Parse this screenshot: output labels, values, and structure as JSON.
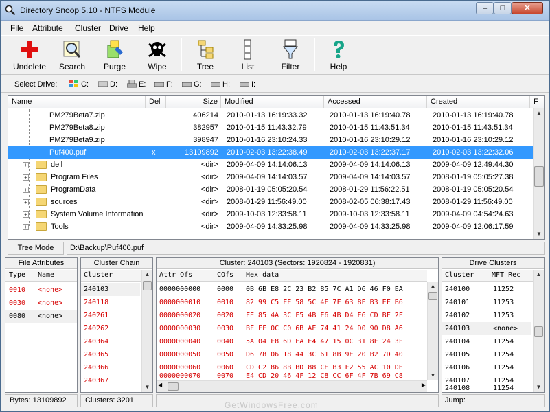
{
  "window": {
    "title": "Directory Snoop 5.10 - NTFS Module",
    "min_label": "–",
    "max_label": "□",
    "close_label": "✕"
  },
  "menu": [
    "File",
    "Attribute",
    "Cluster",
    "Drive",
    "Help"
  ],
  "toolbar": {
    "undelete": "Undelete",
    "search": "Search",
    "purge": "Purge",
    "wipe": "Wipe",
    "tree": "Tree",
    "list": "List",
    "filter": "Filter",
    "help": "Help"
  },
  "drives": {
    "label": "Select Drive:",
    "items": [
      "C:",
      "D:",
      "E:",
      "F:",
      "G:",
      "H:",
      "I:"
    ]
  },
  "file_list": {
    "columns": [
      "Name",
      "Del",
      "Size",
      "Modified",
      "Accessed",
      "Created",
      "F"
    ],
    "rows": [
      {
        "name": "PM279Beta7.zip",
        "del": "",
        "size": "406214",
        "modified": "2010-01-13  16:19:33.32",
        "accessed": "2010-01-13  16:19:40.78",
        "created": "2010-01-13  16:19:40.78"
      },
      {
        "name": "PM279Beta8.zip",
        "del": "",
        "size": "382957",
        "modified": "2010-01-15  11:43:32.79",
        "accessed": "2010-01-15  11:43:51.34",
        "created": "2010-01-15  11:43:51.34"
      },
      {
        "name": "PM279Beta9.zip",
        "del": "",
        "size": "398947",
        "modified": "2010-01-16  23:10:24.33",
        "accessed": "2010-01-16  23:10:29.12",
        "created": "2010-01-16  23:10:29.12"
      },
      {
        "name": "Puf400.puf",
        "del": "x",
        "size": "13109892",
        "modified": "2010-02-03  13:22:38.49",
        "accessed": "2010-02-03  13:22:37.17",
        "created": "2010-02-03  13:22:32.06"
      },
      {
        "name": "dell",
        "del": "",
        "size": "<dir>",
        "modified": "2009-04-09  14:14:06.13",
        "accessed": "2009-04-09  14:14:06.13",
        "created": "2009-04-09  12:49:44.30"
      },
      {
        "name": "Program Files",
        "del": "",
        "size": "<dir>",
        "modified": "2009-04-09  14:14:03.57",
        "accessed": "2009-04-09  14:14:03.57",
        "created": "2008-01-19  05:05:27.38"
      },
      {
        "name": "ProgramData",
        "del": "",
        "size": "<dir>",
        "modified": "2008-01-19  05:05:20.54",
        "accessed": "2008-01-29  11:56:22.51",
        "created": "2008-01-19  05:05:20.54"
      },
      {
        "name": "sources",
        "del": "",
        "size": "<dir>",
        "modified": "2008-01-29  11:56:49.00",
        "accessed": "2008-02-05  06:38:17.43",
        "created": "2008-01-29  11:56:49.00"
      },
      {
        "name": "System Volume Information",
        "del": "",
        "size": "<dir>",
        "modified": "2009-10-03  12:33:58.11",
        "accessed": "2009-10-03  12:33:58.11",
        "created": "2009-04-09  04:54:24.63"
      },
      {
        "name": "Tools",
        "del": "",
        "size": "<dir>",
        "modified": "2009-04-09  14:33:25.98",
        "accessed": "2009-04-09  14:33:25.98",
        "created": "2009-04-09  12:06:17.59"
      }
    ]
  },
  "status": {
    "mode": "Tree Mode",
    "path": "D:\\Backup\\Puf400.puf"
  },
  "file_attributes": {
    "title": "File Attributes",
    "headers": [
      "Type",
      "Name"
    ],
    "rows": [
      {
        "type": "0010",
        "name": "<none>"
      },
      {
        "type": "0030",
        "name": "<none>"
      },
      {
        "type": "0080",
        "name": "<none>"
      }
    ],
    "footer": "Bytes: 13109892"
  },
  "cluster_chain": {
    "title": "Cluster Chain",
    "header": "Cluster",
    "rows": [
      "240103",
      "240118",
      "240261",
      "240262",
      "240364",
      "240365",
      "240366",
      "240367"
    ],
    "footer": "Clusters: 3201"
  },
  "hex_view": {
    "title": "Cluster: 240103 (Sectors: 1920824 - 1920831)",
    "headers": [
      "Attr Ofs",
      "COfs",
      "Hex data"
    ],
    "rows": [
      {
        "ofs": "0000000000",
        "cofs": "0000",
        "hex": "0B 6B E8 2C 23 B2 85 7C A1 D6 46 F0 EA"
      },
      {
        "ofs": "0000000010",
        "cofs": "0010",
        "hex": "82 99 C5 FE 58 5C 4F 7F 63 8E B3 EF B6"
      },
      {
        "ofs": "0000000020",
        "cofs": "0020",
        "hex": "FE 85 4A 3C F5 4B E6 4B D4 E6 CD BF 2F"
      },
      {
        "ofs": "0000000030",
        "cofs": "0030",
        "hex": "BF FF 0C C0 6B AE 74 41 24 D0 90 D8 A6"
      },
      {
        "ofs": "0000000040",
        "cofs": "0040",
        "hex": "5A 04 F8 6D EA E4 47 15 0C 31 8F 24 3F"
      },
      {
        "ofs": "0000000050",
        "cofs": "0050",
        "hex": "D6 78 06 18 44 3C 61 8B 9E 20 B2 7D 40"
      },
      {
        "ofs": "0000000060",
        "cofs": "0060",
        "hex": "CD C2 86 8B BD 88 CE B3 F2 55 AC 10 DE"
      },
      {
        "ofs": "0000000070",
        "cofs": "0070",
        "hex": "E4 CD 20 46 4F 12 C8 CC 6F 4F 7B 69 C8"
      }
    ]
  },
  "drive_clusters": {
    "title": "Drive Clusters",
    "headers": [
      "Cluster",
      "MFT Rec"
    ],
    "rows": [
      {
        "cluster": "240100",
        "mft": "11252"
      },
      {
        "cluster": "240101",
        "mft": "11253"
      },
      {
        "cluster": "240102",
        "mft": "11253"
      },
      {
        "cluster": "240103",
        "mft": "<none>"
      },
      {
        "cluster": "240104",
        "mft": "11254"
      },
      {
        "cluster": "240105",
        "mft": "11254"
      },
      {
        "cluster": "240106",
        "mft": "11254"
      },
      {
        "cluster": "240107",
        "mft": "11254"
      },
      {
        "cluster": "240108",
        "mft": "11254"
      }
    ],
    "footer": "Jump:"
  },
  "colors": {
    "selection": "#3399ff",
    "deleted_red": "#d60000",
    "title_bar": "#b9d1ea"
  },
  "watermark": "GetWindowsFree.com"
}
